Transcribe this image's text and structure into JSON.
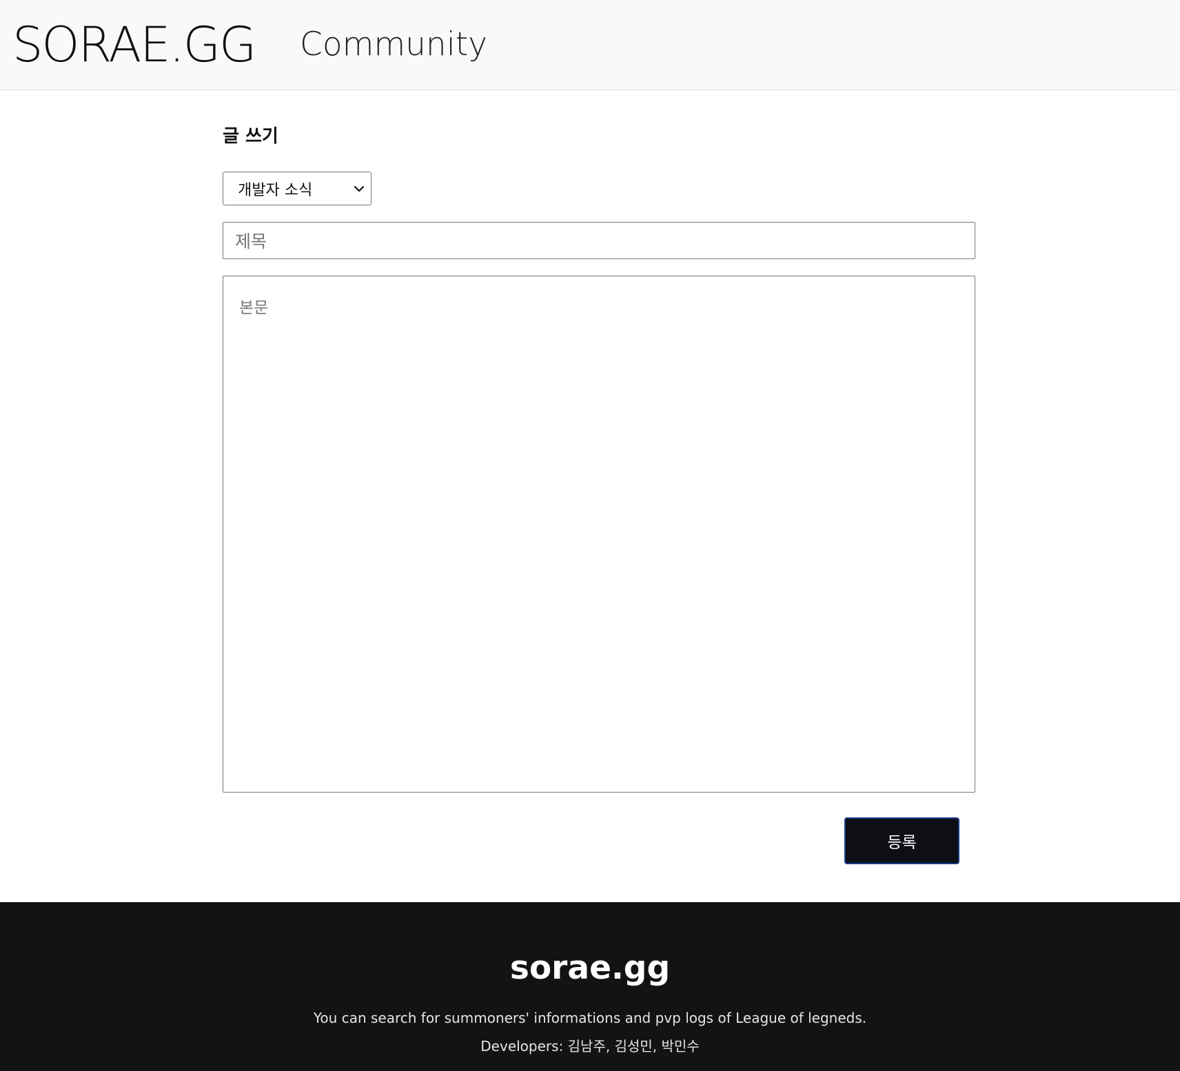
{
  "header": {
    "logo": "SORAE.GG",
    "nav_community": "Community"
  },
  "form": {
    "heading": "글 쓰기",
    "category_selected": "개발자 소식",
    "title_placeholder": "제목",
    "body_placeholder": "본문",
    "submit_label": "등록"
  },
  "footer": {
    "brand": "sorae.gg",
    "description": "You can search for summoners' informations and pvp logs of League of legneds.",
    "developers": "Developers: 김남주, 김성민, 박민수"
  },
  "icons": {
    "select_arrow": "chevron-down-icon"
  },
  "colors": {
    "header_bg": "#f8f9fa",
    "footer_bg": "#131313",
    "button_bg": "#0d0f14",
    "button_border": "#1a3a8a"
  }
}
